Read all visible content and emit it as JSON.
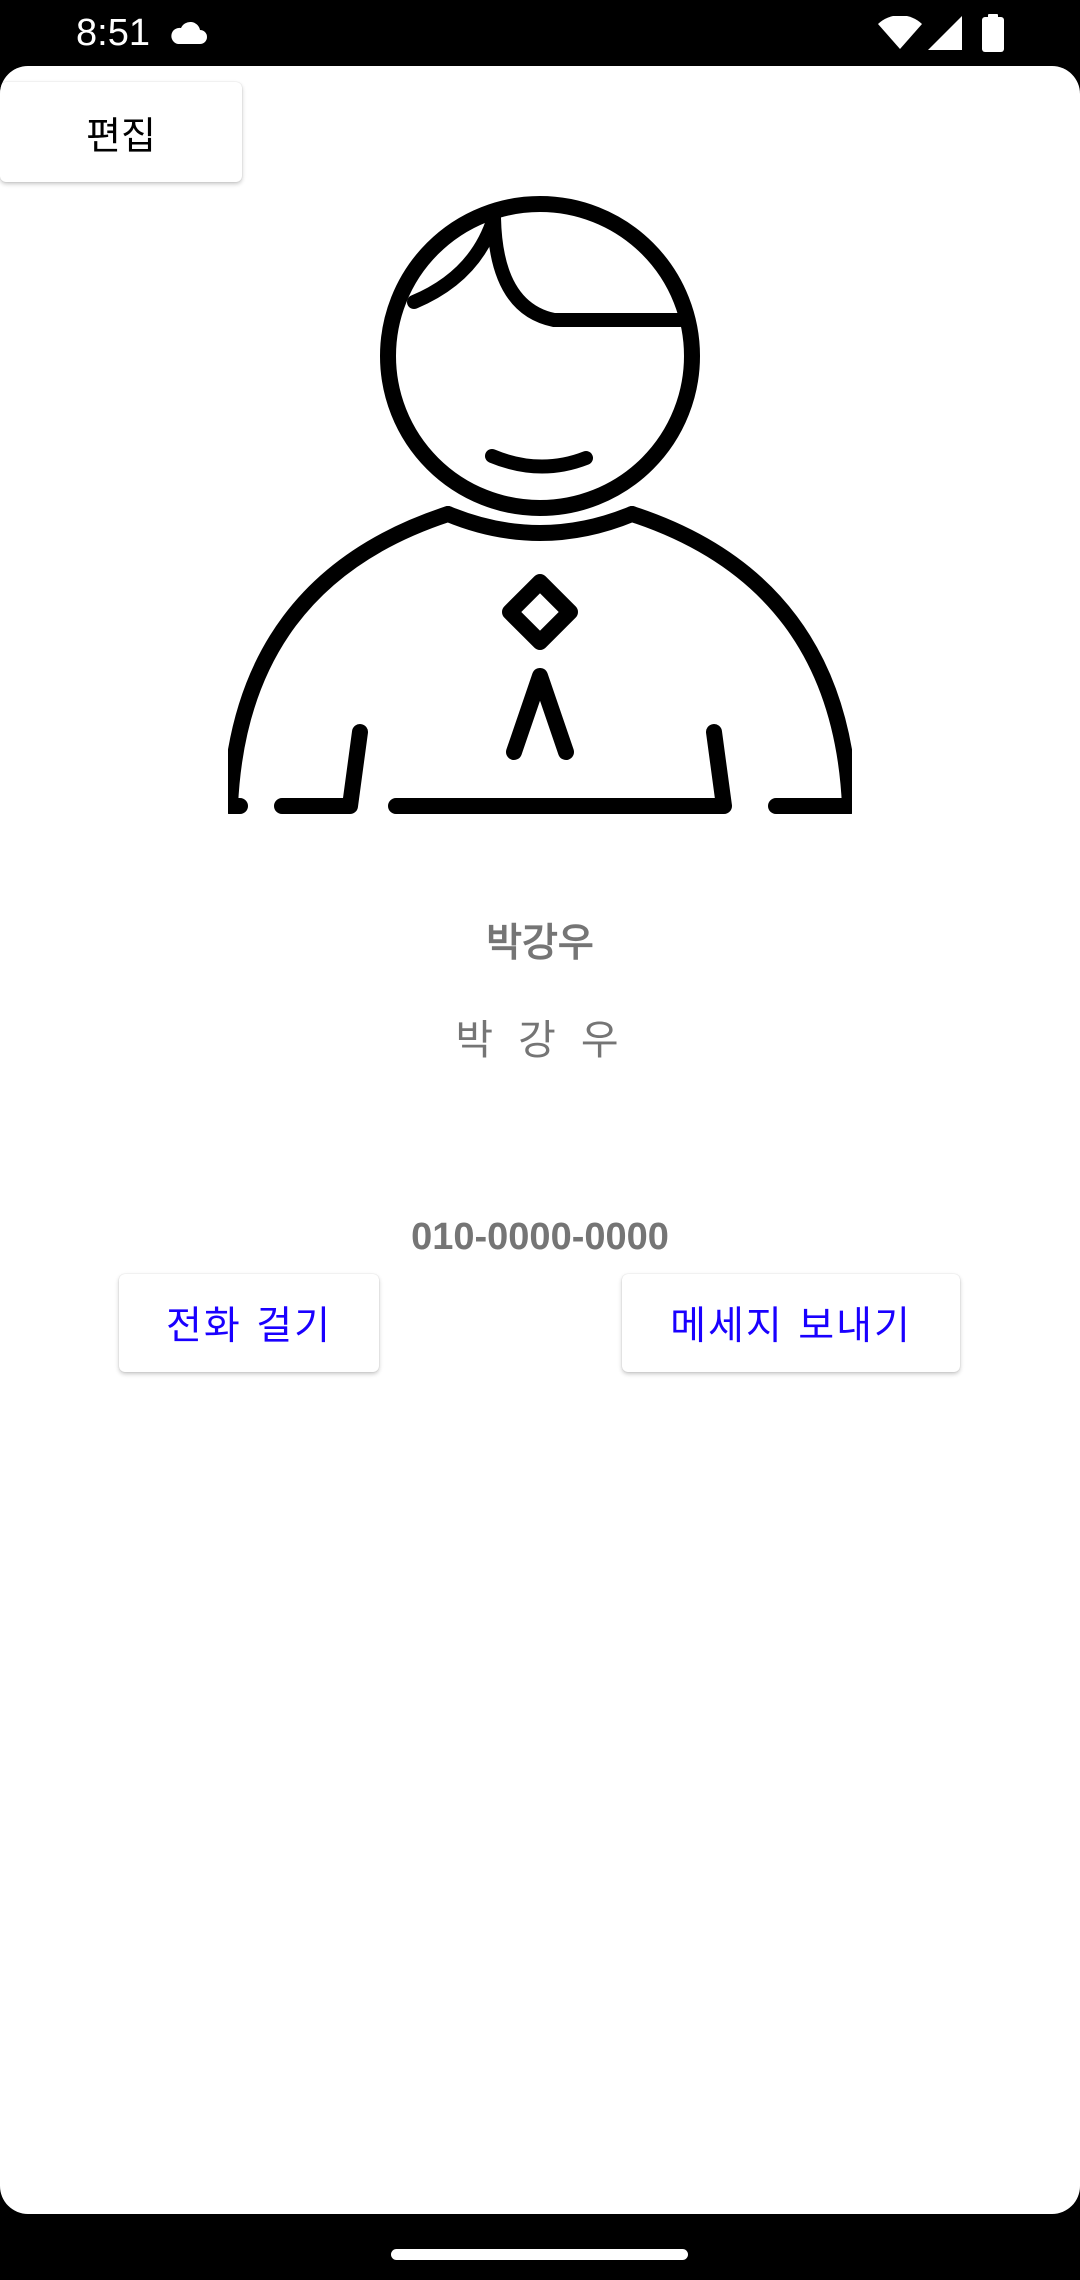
{
  "status_bar": {
    "time": "8:51",
    "icons": [
      "cloud-icon",
      "wifi-icon",
      "signal-icon",
      "battery-icon"
    ]
  },
  "toolbar": {
    "edit_label": "편집"
  },
  "contact": {
    "avatar_icon": "person-avatar-icon",
    "name": "박강우",
    "name_spaced": "박 강 우",
    "phone": "010-0000-0000"
  },
  "actions": {
    "call_label": "전화 걸기",
    "message_label": "메세지 보내기"
  },
  "colors": {
    "action_text": "#1a00ff",
    "secondary_text": "#757575",
    "background": "#ffffff",
    "system_bars": "#000000"
  }
}
